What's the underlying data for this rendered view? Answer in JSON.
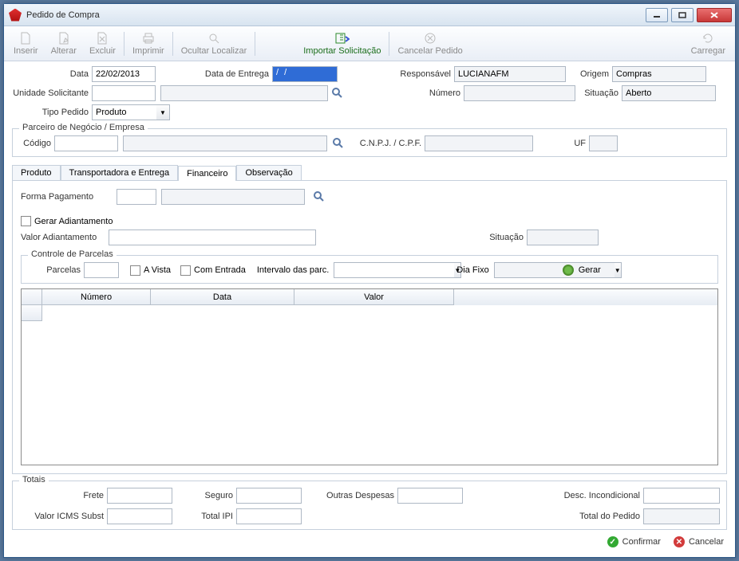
{
  "window": {
    "title": "Pedido de Compra"
  },
  "toolbar": {
    "inserir": "Inserir",
    "alterar": "Alterar",
    "excluir": "Excluir",
    "imprimir": "Imprimir",
    "ocultar": "Ocultar Localizar",
    "importar": "Importar Solicitação",
    "cancelarped": "Cancelar Pedido",
    "carregar": "Carregar"
  },
  "header": {
    "data_lbl": "Data",
    "data_val": "22/02/2013",
    "dataentrega_lbl": "Data de Entrega",
    "dataentrega_val": "  /  /    ",
    "responsavel_lbl": "Responsável",
    "responsavel_val": "LUCIANAFM",
    "origem_lbl": "Origem",
    "origem_val": "Compras",
    "unidade_lbl": "Unidade Solicitante",
    "unidade_val": "",
    "numero_lbl": "Número",
    "numero_val": "",
    "situacao_lbl": "Situação",
    "situacao_val": "Aberto",
    "tipopedido_lbl": "Tipo Pedido",
    "tipopedido_val": "Produto"
  },
  "parceiro": {
    "legend": "Parceiro de Negócio / Empresa",
    "codigo_lbl": "Código",
    "codigo_val": "",
    "cnpj_lbl": "C.N.P.J. / C.P.F.",
    "cnpj_val": "",
    "uf_lbl": "UF",
    "uf_val": ""
  },
  "tabs": {
    "produto": "Produto",
    "transp": "Transportadora e Entrega",
    "financeiro": "Financeiro",
    "obs": "Observação"
  },
  "financeiro": {
    "forma_lbl": "Forma Pagamento",
    "gerar_adiant": "Gerar Adiantamento",
    "valor_adiant_lbl": "Valor Adiantamento",
    "situacao_lbl": "Situação",
    "controle_leg": "Controle de Parcelas",
    "parcelas_lbl": "Parcelas",
    "avista_lbl": "A Vista",
    "comentrada_lbl": "Com Entrada",
    "intervalo_lbl": "Intervalo das parc.",
    "diafixo_lbl": "Dia Fixo",
    "gerar_btn": "Gerar",
    "grid_numero": "Número",
    "grid_data": "Data",
    "grid_valor": "Valor"
  },
  "totais": {
    "legend": "Totais",
    "frete": "Frete",
    "seguro": "Seguro",
    "outras": "Outras Despesas",
    "descincond": "Desc. Incondicional",
    "icms": "Valor ICMS Subst",
    "totalipi": "Total IPI",
    "totalped": "Total do Pedido"
  },
  "footer": {
    "confirmar": "Confirmar",
    "cancelar": "Cancelar"
  }
}
